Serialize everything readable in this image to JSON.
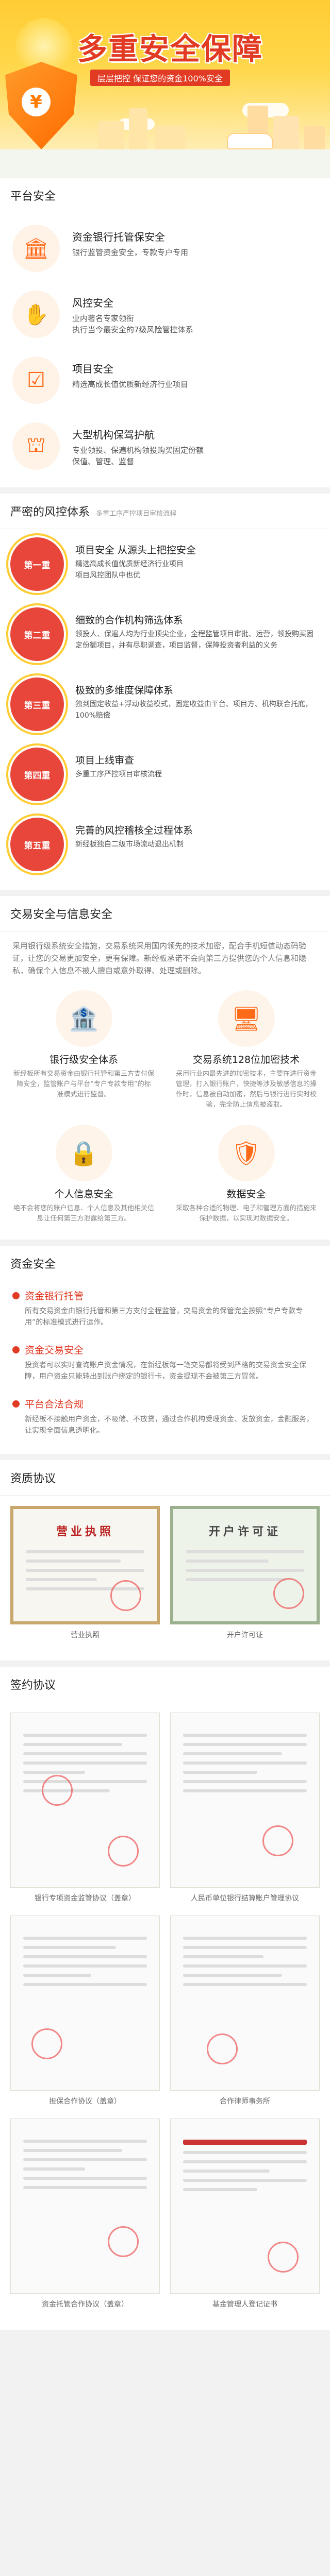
{
  "hero": {
    "title": "多重安全保障",
    "subtitle": "层层把控  保证您的资金100%安全",
    "shield_glyph": "¥"
  },
  "platform": {
    "heading": "平台安全",
    "items": [
      {
        "icon": "bank-icon",
        "glyph": "🏛",
        "title": "资金银行托管保安全",
        "desc": "银行监管资金安全，专款专户专用"
      },
      {
        "icon": "control-icon",
        "glyph": "✋",
        "title": "风控安全",
        "desc": "业内著名专家领衔\n执行当今最安全的7级风险管控体系"
      },
      {
        "icon": "project-icon",
        "glyph": "☑",
        "title": "项目安全",
        "desc": "精选高成长值优质新经济行业项目"
      },
      {
        "icon": "institution-icon",
        "glyph": "⛫",
        "title": "大型机构保驾护航",
        "desc": "专业领投、保遍机构领投购买固定份额\n保值、管理、监督"
      }
    ]
  },
  "risk": {
    "heading": "严密的风控体系",
    "subheading": "多重工序严控项目审核流程",
    "steps": [
      {
        "badge": "第一重",
        "title": "项目安全 从源头上把控安全",
        "desc": "精选高成长值优质新经济行业项目\n项目风控团队中也优"
      },
      {
        "badge": "第二重",
        "title": "细致的合作机构筛选体系",
        "desc": "领投人、保遍人均为行业顶尖企业，全程监管项目审批、运营，领投购买固定份额项目，并有尽职调查，项目监督，保障投资者利益的义务"
      },
      {
        "badge": "第三重",
        "title": "极致的多维度保障体系",
        "desc": "独到固定收益+浮动收益模式，固定收益由平台、项目方、机构联合托底，100%赔偿"
      },
      {
        "badge": "第四重",
        "title": "项目上线审查",
        "desc": "多重工序严控项目审核流程"
      },
      {
        "badge": "第五重",
        "title": "完善的风控稽核全过程体系",
        "desc": "新经板独自二级市场流动退出机制"
      }
    ]
  },
  "trade": {
    "heading": "交易安全与信息安全",
    "intro": "采用银行级系统安全措施，交易系统采用国内领先的技术加密，配合手机短信动态码验证，让您的交易更加安全，更有保障。新经板承诺不会向第三方提供您的个人信息和隐私，确保个人信息不被人擅自或意外取得、处理或删除。",
    "items": [
      {
        "icon": "bank-system-icon",
        "glyph": "🏦",
        "title": "银行级安全体系",
        "desc": "新经板所有交易资金由银行托管和第三方支付保障安全，监管账户与平台“专户专款专用”的标准模式进行监督。"
      },
      {
        "icon": "encryption-icon",
        "glyph": "🖥",
        "title": "交易系统128位加密技术",
        "desc": "采用行业内最先进的加密技术，主要在进行资金管理，打入银行账户，快捷等涉及敏感信息的操作时，信息被自动加密，然后与银行进行实时校验，完全防止信息被盗取。"
      },
      {
        "icon": "privacy-icon",
        "glyph": "🔒",
        "title": "个人信息安全",
        "desc": "绝不会将您的账户信息、个人信息及其他相关信息让任何第三方泄露给第三方。"
      },
      {
        "icon": "data-icon",
        "glyph": "🛡",
        "title": "数据安全",
        "desc": "采取各种合适的物理、电子和管理方面的措施来保护数据，以实现对数据安全。"
      }
    ]
  },
  "fund": {
    "heading": "资金安全",
    "items": [
      {
        "title": "资金银行托管",
        "desc": "所有交易资金由银行托管和第三方支付全程监管，交易资金的保管完全按照“专户专款专用”的标准模式进行运作。"
      },
      {
        "title": "资金交易安全",
        "desc": "投资者可以实时查询账户资金情况，在新经板每一笔交易都将受到严格的交易资金安全保障，用户资金只能转出到账户绑定的银行卡，资金提现不会被第三方冒领。"
      },
      {
        "title": "平台合法合规",
        "desc": "新经板不接触用户资金，不吸储、不放贷，通过合作机构受理资金、发放资金，金融服务，让实现全面信息透明化。"
      }
    ]
  },
  "qualification": {
    "heading": "资质协议",
    "items": [
      {
        "caption": "营业执照",
        "doc_title": "营业执照"
      },
      {
        "caption": "开户许可证",
        "doc_title": "开户许可证"
      }
    ]
  },
  "contracts": {
    "heading": "签约协议",
    "items": [
      {
        "caption": "银行专项资金监管协议（盖章）"
      },
      {
        "caption": "人民币单位银行结算账户管理协议"
      },
      {
        "caption": "担保合作协议（盖章）"
      },
      {
        "caption": "合作律师事务所"
      },
      {
        "caption": "资金托管合作协议（盖章）"
      },
      {
        "caption": "基金管理人登记证书"
      }
    ]
  }
}
